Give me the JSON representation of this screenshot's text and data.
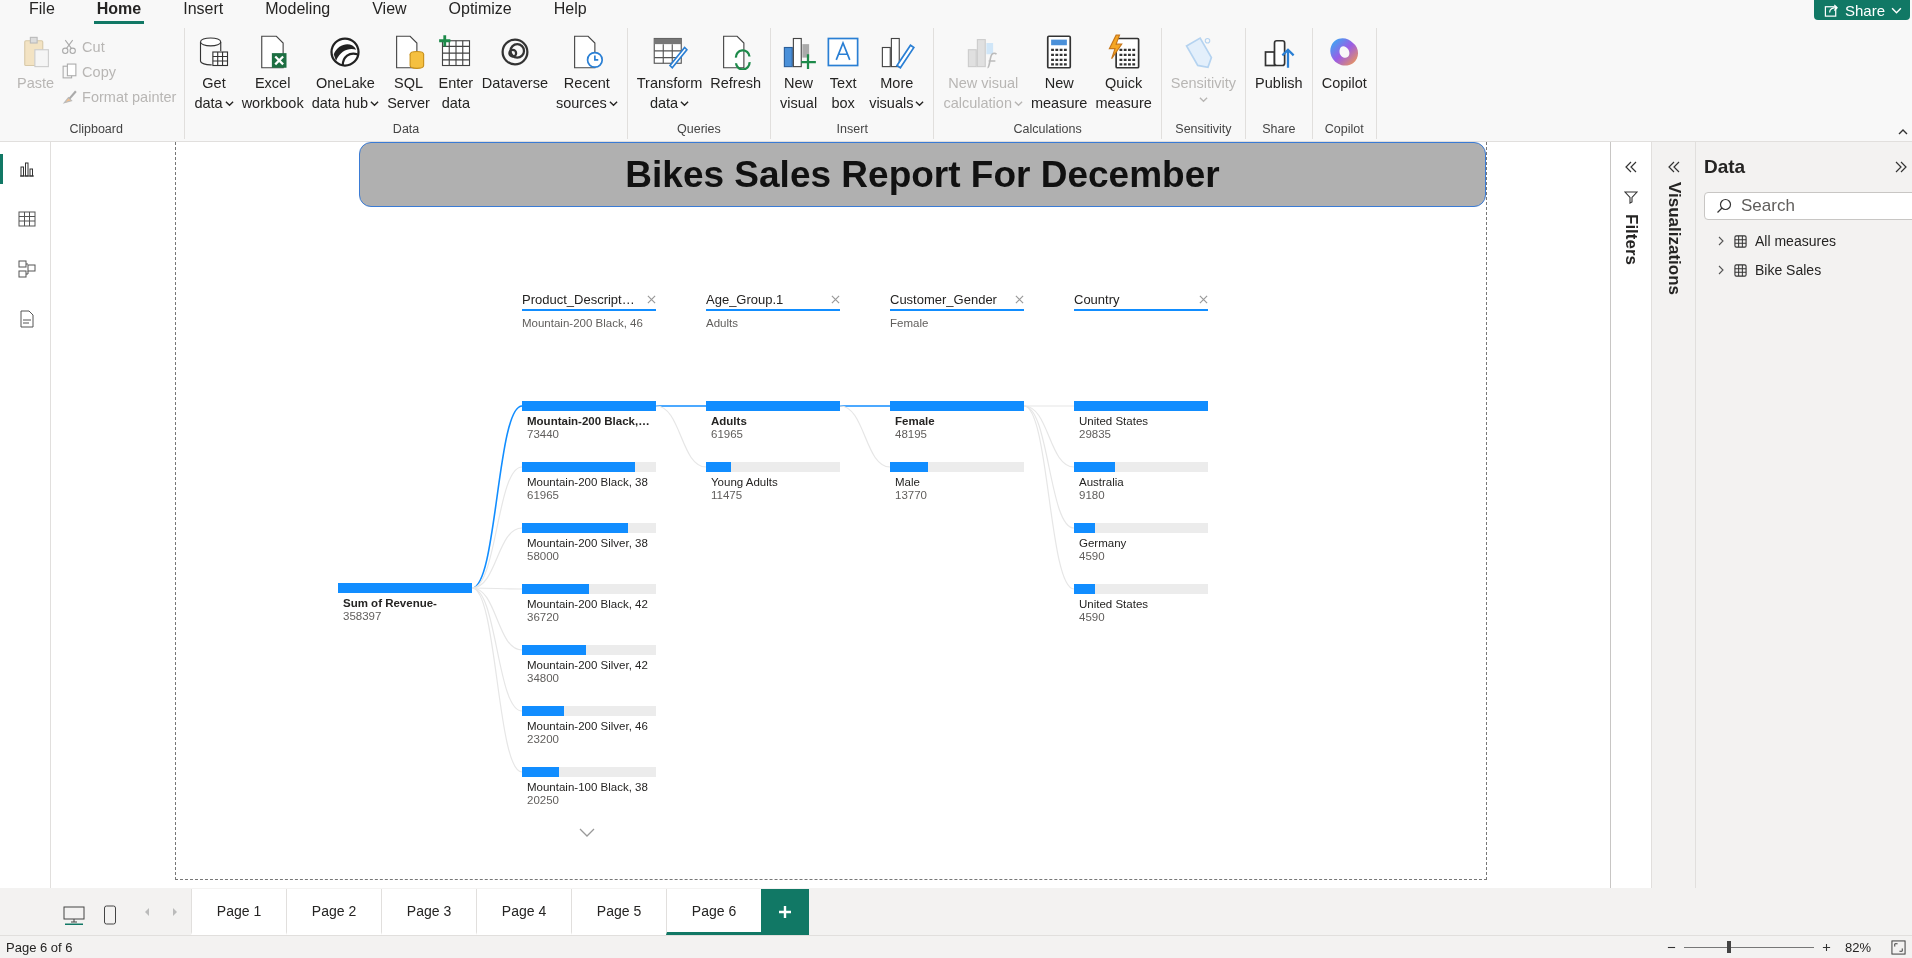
{
  "menu": [
    {
      "label": "File",
      "selected": false
    },
    {
      "label": "Home",
      "selected": true
    },
    {
      "label": "Insert",
      "selected": false
    },
    {
      "label": "Modeling",
      "selected": false
    },
    {
      "label": "View",
      "selected": false
    },
    {
      "label": "Optimize",
      "selected": false
    },
    {
      "label": "Help",
      "selected": false
    }
  ],
  "share_button": {
    "label": "Share"
  },
  "ribbon": [
    {
      "label": "Clipboard",
      "buttons": [
        {
          "label": "Paste",
          "kind": "large",
          "disabled": true,
          "dropdown": false
        },
        {
          "label": "Cut",
          "kind": "small",
          "disabled": true
        },
        {
          "label": "Copy",
          "kind": "small",
          "disabled": true
        },
        {
          "label": "Format painter",
          "kind": "small",
          "disabled": true
        }
      ]
    },
    {
      "label": "Data",
      "buttons": [
        {
          "label": "Get\ndata",
          "kind": "large",
          "disabled": false,
          "dropdown": true
        },
        {
          "label": "Excel\nworkbook",
          "kind": "large",
          "disabled": false,
          "dropdown": false
        },
        {
          "label": "OneLake\ndata hub",
          "kind": "large",
          "disabled": false,
          "dropdown": true
        },
        {
          "label": "SQL\nServer",
          "kind": "large",
          "disabled": false,
          "dropdown": false
        },
        {
          "label": "Enter\ndata",
          "kind": "large",
          "disabled": false,
          "dropdown": false
        },
        {
          "label": "Dataverse",
          "kind": "large",
          "disabled": false,
          "dropdown": false
        },
        {
          "label": "Recent\nsources",
          "kind": "large",
          "disabled": false,
          "dropdown": true
        }
      ]
    },
    {
      "label": "Queries",
      "buttons": [
        {
          "label": "Transform\ndata",
          "kind": "large",
          "disabled": false,
          "dropdown": true
        },
        {
          "label": "Refresh",
          "kind": "large",
          "disabled": false,
          "dropdown": false
        }
      ]
    },
    {
      "label": "Insert",
      "buttons": [
        {
          "label": "New\nvisual",
          "kind": "large",
          "disabled": false,
          "dropdown": false
        },
        {
          "label": "Text\nbox",
          "kind": "large",
          "disabled": false,
          "dropdown": false
        },
        {
          "label": "More\nvisuals",
          "kind": "large",
          "disabled": false,
          "dropdown": true
        }
      ]
    },
    {
      "label": "Calculations",
      "buttons": [
        {
          "label": "New visual\ncalculation",
          "kind": "large",
          "disabled": true,
          "dropdown": true
        },
        {
          "label": "New\nmeasure",
          "kind": "large",
          "disabled": false,
          "dropdown": false
        },
        {
          "label": "Quick\nmeasure",
          "kind": "large",
          "disabled": false,
          "dropdown": false
        }
      ]
    },
    {
      "label": "Sensitivity",
      "buttons": [
        {
          "label": "Sensitivity",
          "kind": "large",
          "disabled": true,
          "dropdown": true
        }
      ]
    },
    {
      "label": "Share",
      "buttons": [
        {
          "label": "Publish",
          "kind": "large",
          "disabled": false,
          "dropdown": false
        }
      ]
    },
    {
      "label": "Copilot",
      "buttons": [
        {
          "label": "Copilot",
          "kind": "large",
          "disabled": false,
          "dropdown": false
        }
      ]
    }
  ],
  "view_switcher": [
    {
      "selected": true
    },
    {
      "selected": false
    },
    {
      "selected": false
    },
    {
      "selected": false
    }
  ],
  "report": {
    "title": "Bikes Sales Report For December",
    "tree": {
      "root": {
        "label": "Sum of Revenue-",
        "value": "358397",
        "level": 1
      },
      "levels": [
        {
          "header": "Product_Descript…",
          "selection": "Mountain-200 Black, 46",
          "nodes": [
            {
              "label": "Mountain-200 Black,…",
              "value": "73440",
              "level": 1,
              "selected": true
            },
            {
              "label": "Mountain-200 Black, 38",
              "value": "61965",
              "level": 0.844,
              "selected": false
            },
            {
              "label": "Mountain-200 Silver, 38",
              "value": "58000",
              "level": 0.79,
              "selected": false
            },
            {
              "label": "Mountain-200 Black, 42",
              "value": "36720",
              "level": 0.5,
              "selected": false
            },
            {
              "label": "Mountain-200 Silver, 42",
              "value": "34800",
              "level": 0.474,
              "selected": false
            },
            {
              "label": "Mountain-200 Silver, 46",
              "value": "23200",
              "level": 0.316,
              "selected": false
            },
            {
              "label": "Mountain-100 Black, 38",
              "value": "20250",
              "level": 0.276,
              "selected": false
            }
          ]
        },
        {
          "header": "Age_Group.1",
          "selection": "Adults",
          "nodes": [
            {
              "label": "Adults",
              "value": "61965",
              "level": 1,
              "selected": true
            },
            {
              "label": "Young Adults",
              "value": "11475",
              "level": 0.185,
              "selected": false
            }
          ]
        },
        {
          "header": "Customer_Gender",
          "selection": "Female",
          "nodes": [
            {
              "label": "Female",
              "value": "48195",
              "level": 1,
              "selected": true
            },
            {
              "label": "Male",
              "value": "13770",
              "level": 0.286,
              "selected": false
            }
          ]
        },
        {
          "header": "Country",
          "nodes": [
            {
              "label": "United States",
              "value": "29835",
              "level": 1,
              "selected": false
            },
            {
              "label": "Australia",
              "value": "9180",
              "level": 0.308,
              "selected": false
            },
            {
              "label": "Germany",
              "value": "4590",
              "level": 0.154,
              "selected": false
            },
            {
              "label": "United States",
              "value": "4590",
              "level": 0.154,
              "selected": false
            }
          ]
        }
      ]
    }
  },
  "filters_pane": {
    "label": "Filters"
  },
  "visualizations_pane": {
    "label": "Visualizations"
  },
  "data_pane": {
    "title": "Data",
    "search": {
      "placeholder": "Search"
    },
    "items": [
      {
        "label": "All measures"
      },
      {
        "label": "Bike Sales"
      }
    ]
  },
  "page_tabs": [
    {
      "label": "Page 1",
      "selected": false
    },
    {
      "label": "Page 2",
      "selected": false
    },
    {
      "label": "Page 3",
      "selected": false
    },
    {
      "label": "Page 4",
      "selected": false
    },
    {
      "label": "Page 5",
      "selected": false
    },
    {
      "label": "Page 6",
      "selected": true
    }
  ],
  "status_bar": {
    "page_info": "Page 6 of 6",
    "zoom": {
      "level": 0.35,
      "reading": "82%"
    }
  }
}
